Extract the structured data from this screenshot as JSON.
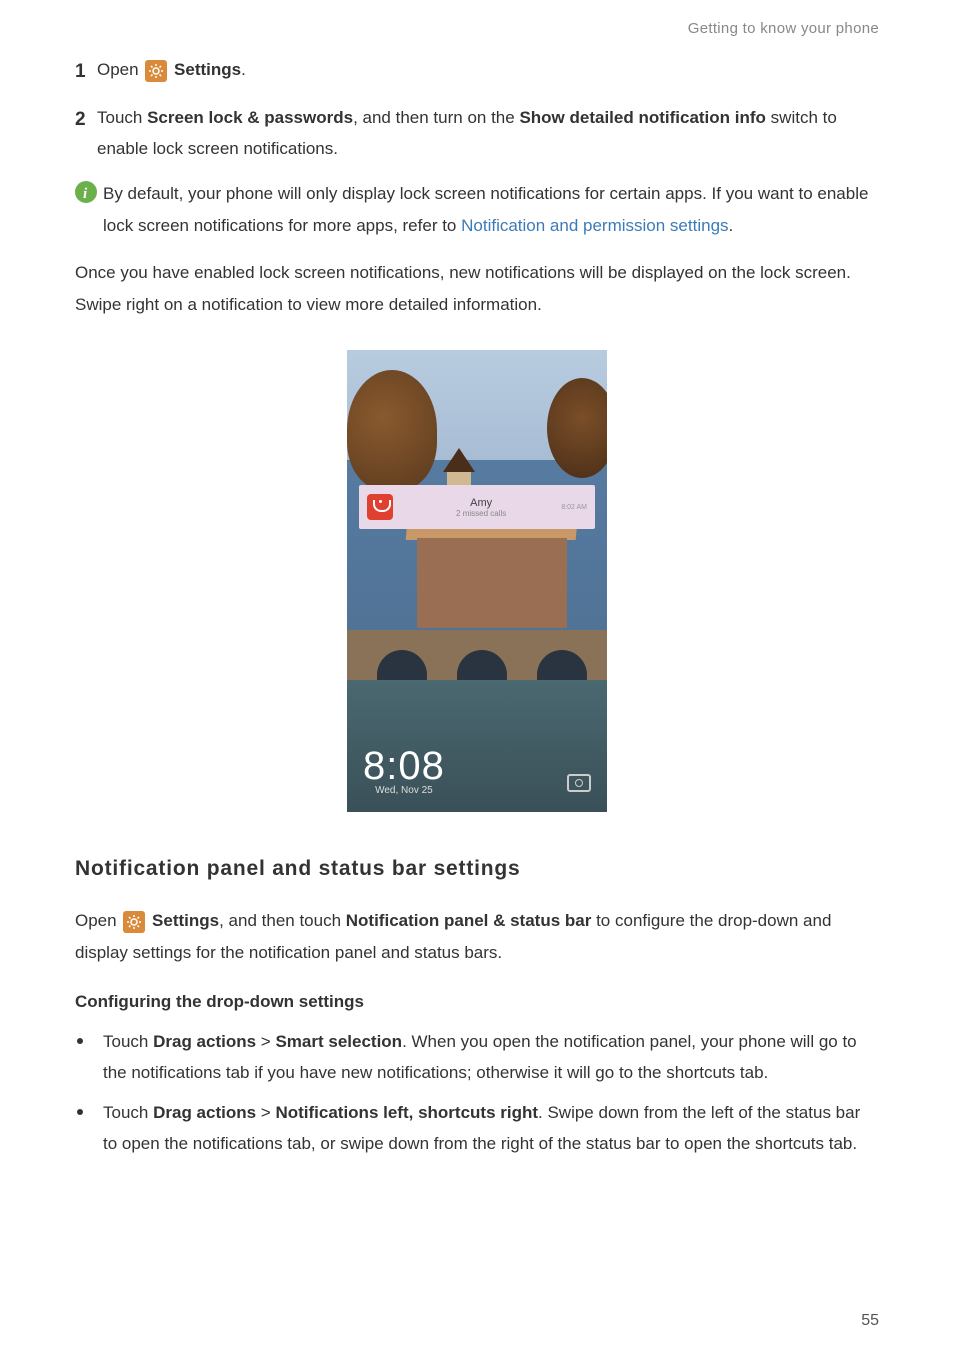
{
  "header": "Getting to know your phone",
  "step1": {
    "num": "1",
    "open": "Open ",
    "settings": "Settings",
    "period": "."
  },
  "step2": {
    "num": "2",
    "touch": "Touch ",
    "bold1": "Screen lock & passwords",
    "mid": ", and then turn on the ",
    "bold2": "Show detailed notification info",
    "tail": " switch to enable lock screen notifications."
  },
  "info": {
    "pre": "By default, your phone will only display lock screen notifications for certain apps. If you want to enable lock screen notifications for more apps, refer to ",
    "link": "Notification and permission settings",
    "post": "."
  },
  "para1": "Once you have enabled lock screen notifications, new notifications will be displayed on the lock screen. Swipe right on a notification to view more detailed information.",
  "notif_card": {
    "name": "Amy",
    "sub": "2 missed calls",
    "time": "8:02 AM"
  },
  "clock": {
    "time": "8:08",
    "date": "Wed, Nov 25"
  },
  "section2_title": "Notification panel and status bar settings",
  "para2": {
    "open": "Open ",
    "settings": "Settings",
    "mid": ", and then touch ",
    "bold": "Notification panel & status bar",
    "tail": " to configure the drop-down and display settings for the notification panel and status bars."
  },
  "sub_title": "Configuring the drop-down settings",
  "bullet1": {
    "touch": "Touch ",
    "b1": "Drag actions",
    "gt": " > ",
    "b2": "Smart selection",
    "tail": ". When you open the notification panel, your phone will go to the notifications tab if you have new notifications; otherwise it will go to the shortcuts tab."
  },
  "bullet2": {
    "touch": "Touch ",
    "b1": "Drag actions",
    "gt": " > ",
    "b2": "Notifications left, shortcuts right",
    "tail": ". Swipe down from the left of the status bar to open the notifications tab, or swipe down from the right of the status bar to open the shortcuts tab."
  },
  "page_num": "55"
}
